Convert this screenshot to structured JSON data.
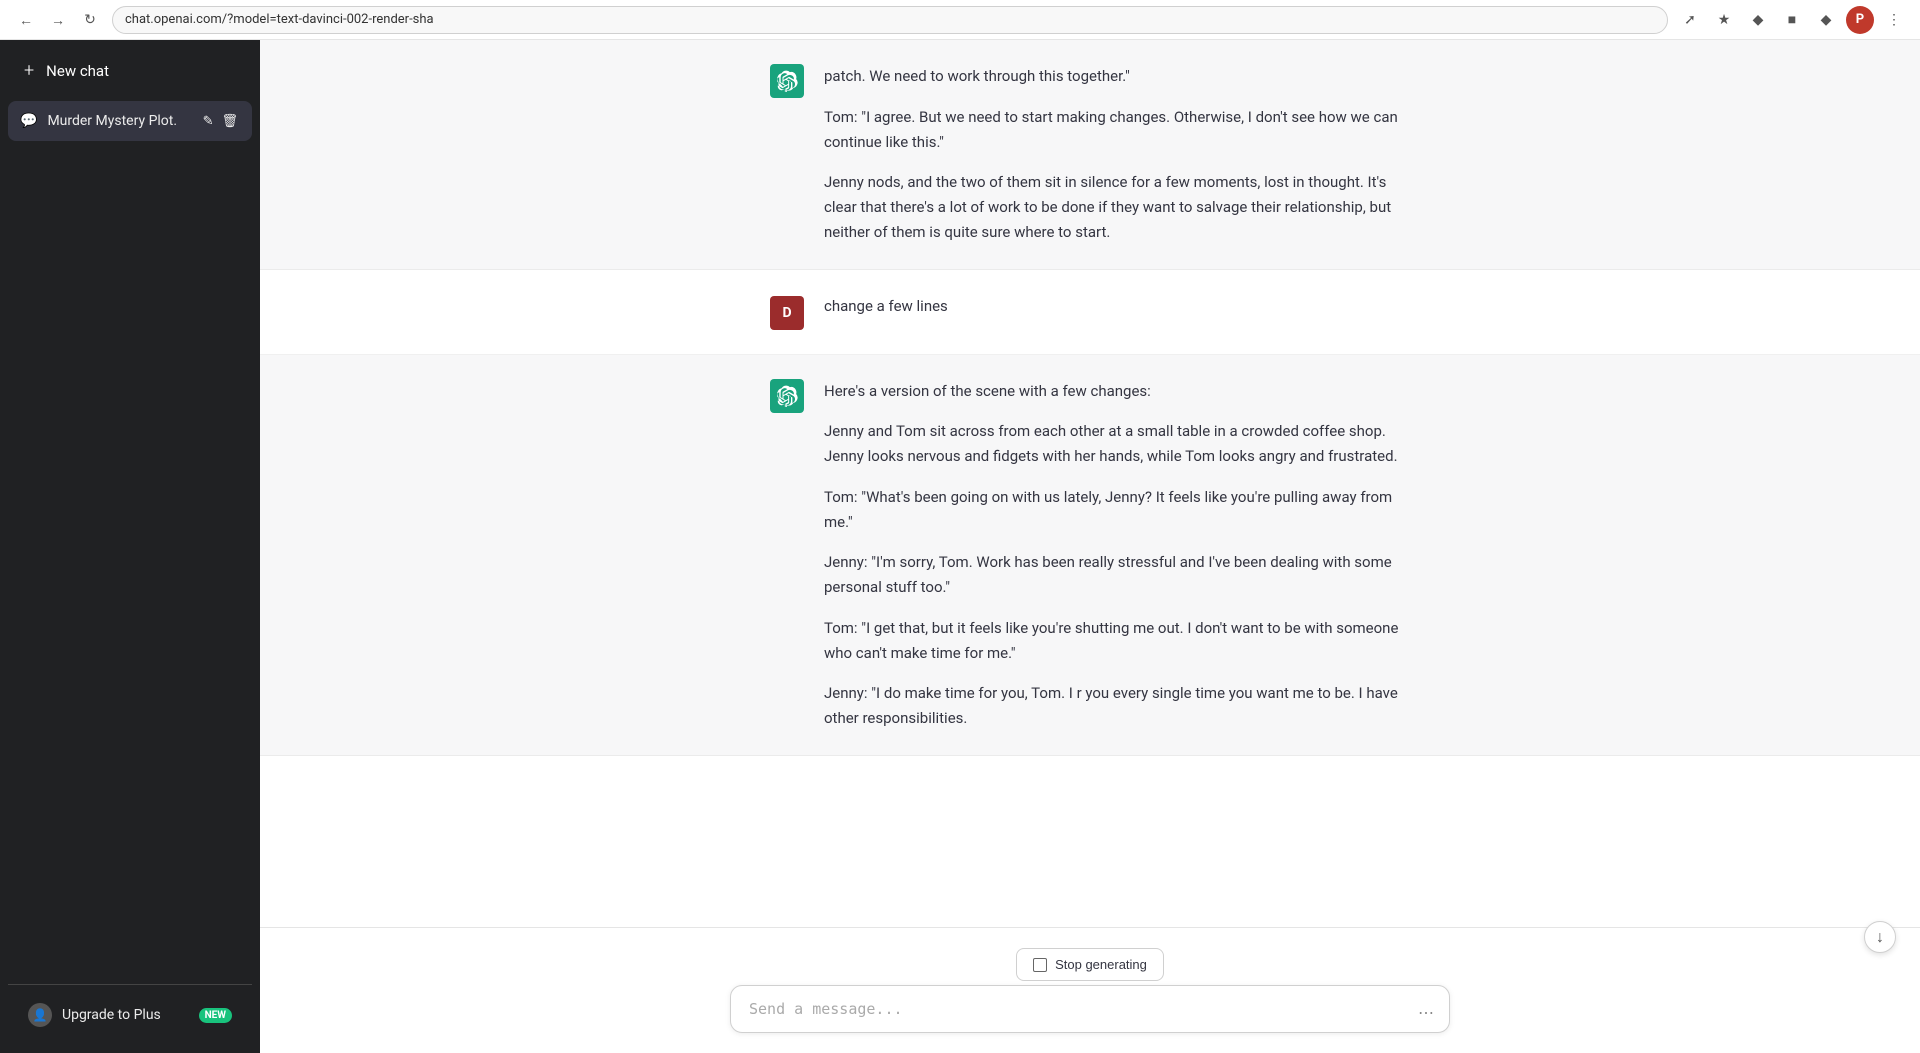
{
  "topbar": {
    "url": "chat.openai.com/?model=text-davinci-002-render-sha"
  },
  "sidebar": {
    "new_chat_label": "New chat",
    "chat_items": [
      {
        "id": "murder-mystery",
        "label": "Murder Mystery Plot.",
        "active": true
      }
    ],
    "upgrade_label": "Upgrade to Plus",
    "upgrade_badge": "NEW"
  },
  "messages": [
    {
      "type": "ai",
      "paragraphs": [
        "patch. We need to work through this together.\"",
        "Tom: \"I agree. But we need to start making changes. Otherwise, I don't see how we can continue like this.\"",
        "Jenny nods, and the two of them sit in silence for a few moments, lost in thought. It's clear that there's a lot of work to be done if they want to salvage their relationship, but neither of them is quite sure where to start."
      ]
    },
    {
      "type": "user",
      "text": "change a few lines",
      "avatar_letter": "D"
    },
    {
      "type": "ai",
      "paragraphs": [
        "Here's a version of the scene with a few changes:",
        "Jenny and Tom sit across from each other at a small table in a crowded coffee shop. Jenny looks nervous and fidgets with her hands, while Tom looks angry and frustrated.",
        "Tom: \"What's been going on with us lately, Jenny? It feels like you're pulling away from me.\"",
        "Jenny: \"I'm sorry, Tom. Work has been really stressful and I've been dealing with some personal stuff too.\"",
        "Tom: \"I get that, but it feels like you're shutting me out. I don't want to be with someone who can't make time for me.\"",
        "Jenny: \"I do make time for you, Tom. I r you every single time you want me to be. I have other responsibilities."
      ]
    }
  ],
  "input": {
    "placeholder": "Send a message..."
  },
  "stop_generating": {
    "label": "Stop generating"
  }
}
